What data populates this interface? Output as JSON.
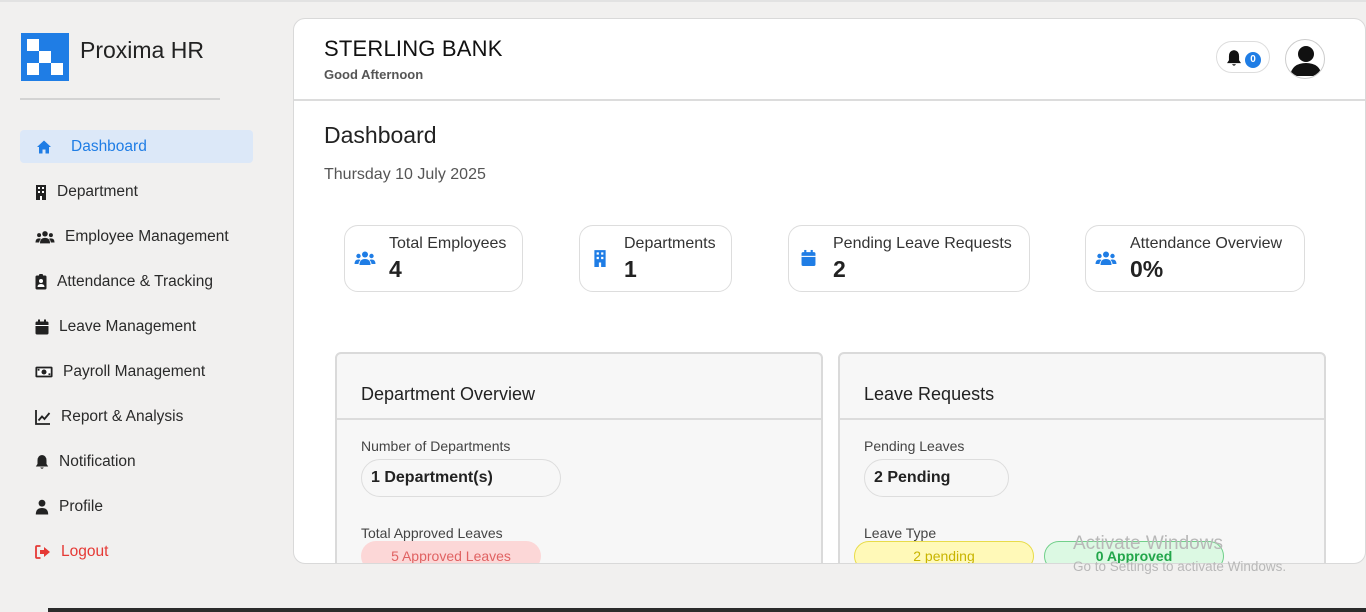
{
  "app": {
    "brand": "Proxima HR"
  },
  "sidebar": {
    "items": [
      {
        "label": "Dashboard",
        "icon": "home-icon",
        "active": true
      },
      {
        "label": "Department",
        "icon": "building-icon"
      },
      {
        "label": "Employee Management",
        "icon": "users-icon"
      },
      {
        "label": "Attendance & Tracking",
        "icon": "id-badge-icon"
      },
      {
        "label": "Leave Management",
        "icon": "calendar-icon"
      },
      {
        "label": "Payroll Management",
        "icon": "money-icon"
      },
      {
        "label": "Report & Analysis",
        "icon": "chart-line-icon"
      },
      {
        "label": "Notification",
        "icon": "bell-icon"
      },
      {
        "label": "Profile",
        "icon": "user-icon"
      },
      {
        "label": "Logout",
        "icon": "logout-icon"
      }
    ]
  },
  "header": {
    "company": "STERLING BANK",
    "greeting": "Good Afternoon",
    "notification_count": "0"
  },
  "page": {
    "title": "Dashboard",
    "date": "Thursday 10 July 2025"
  },
  "stats": [
    {
      "label": "Total Employees",
      "value": "4",
      "icon": "users-icon"
    },
    {
      "label": "Departments",
      "value": "1",
      "icon": "building-icon"
    },
    {
      "label": "Pending Leave Requests",
      "value": "2",
      "icon": "calendar-icon"
    },
    {
      "label": "Attendance Overview",
      "value": "0%",
      "icon": "users-icon"
    }
  ],
  "department_overview": {
    "title": "Department Overview",
    "count_label": "Number of Departments",
    "count_value": "1 Department(s)",
    "approved_label": "Total Approved Leaves",
    "approved_value": "5 Approved Leaves"
  },
  "leave_requests": {
    "title": "Leave Requests",
    "pending_label": "Pending Leaves",
    "pending_value": "2 Pending",
    "type_label": "Leave Type",
    "pending_tag": "2 pending",
    "approved_tag": "0 Approved"
  },
  "os_watermark": {
    "line1": "Activate Windows",
    "line2": "Go to Settings to activate Windows."
  },
  "colors": {
    "accent": "#1f7de5",
    "active_bg": "#dce8f8",
    "logout": "#e53935"
  }
}
